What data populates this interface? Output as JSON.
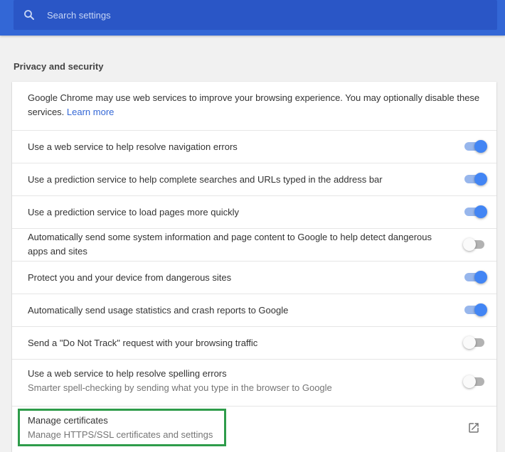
{
  "search": {
    "placeholder": "Search settings",
    "icon": "search-icon"
  },
  "section": {
    "title": "Privacy and security"
  },
  "intro": {
    "text": "Google Chrome may use web services to improve your browsing experience. You may optionally disable these services. ",
    "link": "Learn more"
  },
  "settings": [
    {
      "label": "Use a web service to help resolve navigation errors",
      "enabled": true
    },
    {
      "label": "Use a prediction service to help complete searches and URLs typed in the address bar",
      "enabled": true
    },
    {
      "label": "Use a prediction service to load pages more quickly",
      "enabled": true
    },
    {
      "label": "Automatically send some system information and page content to Google to help detect dangerous apps and sites",
      "enabled": false
    },
    {
      "label": "Protect you and your device from dangerous sites",
      "enabled": true
    },
    {
      "label": "Automatically send usage statistics and crash reports to Google",
      "enabled": true
    },
    {
      "label": "Send a \"Do Not Track\" request with your browsing traffic",
      "enabled": false
    },
    {
      "label": "Use a web service to help resolve spelling errors",
      "sublabel": "Smarter spell-checking by sending what you type in the browser to Google",
      "enabled": false
    }
  ],
  "certificates": {
    "label": "Manage certificates",
    "sublabel": "Manage HTTPS/SSL certificates and settings",
    "icon": "external-link-icon"
  },
  "colors": {
    "header": "#3367d6",
    "search_box": "#2a56c6",
    "toggle_on": "#4285f4",
    "highlight": "#2e9c4a"
  }
}
